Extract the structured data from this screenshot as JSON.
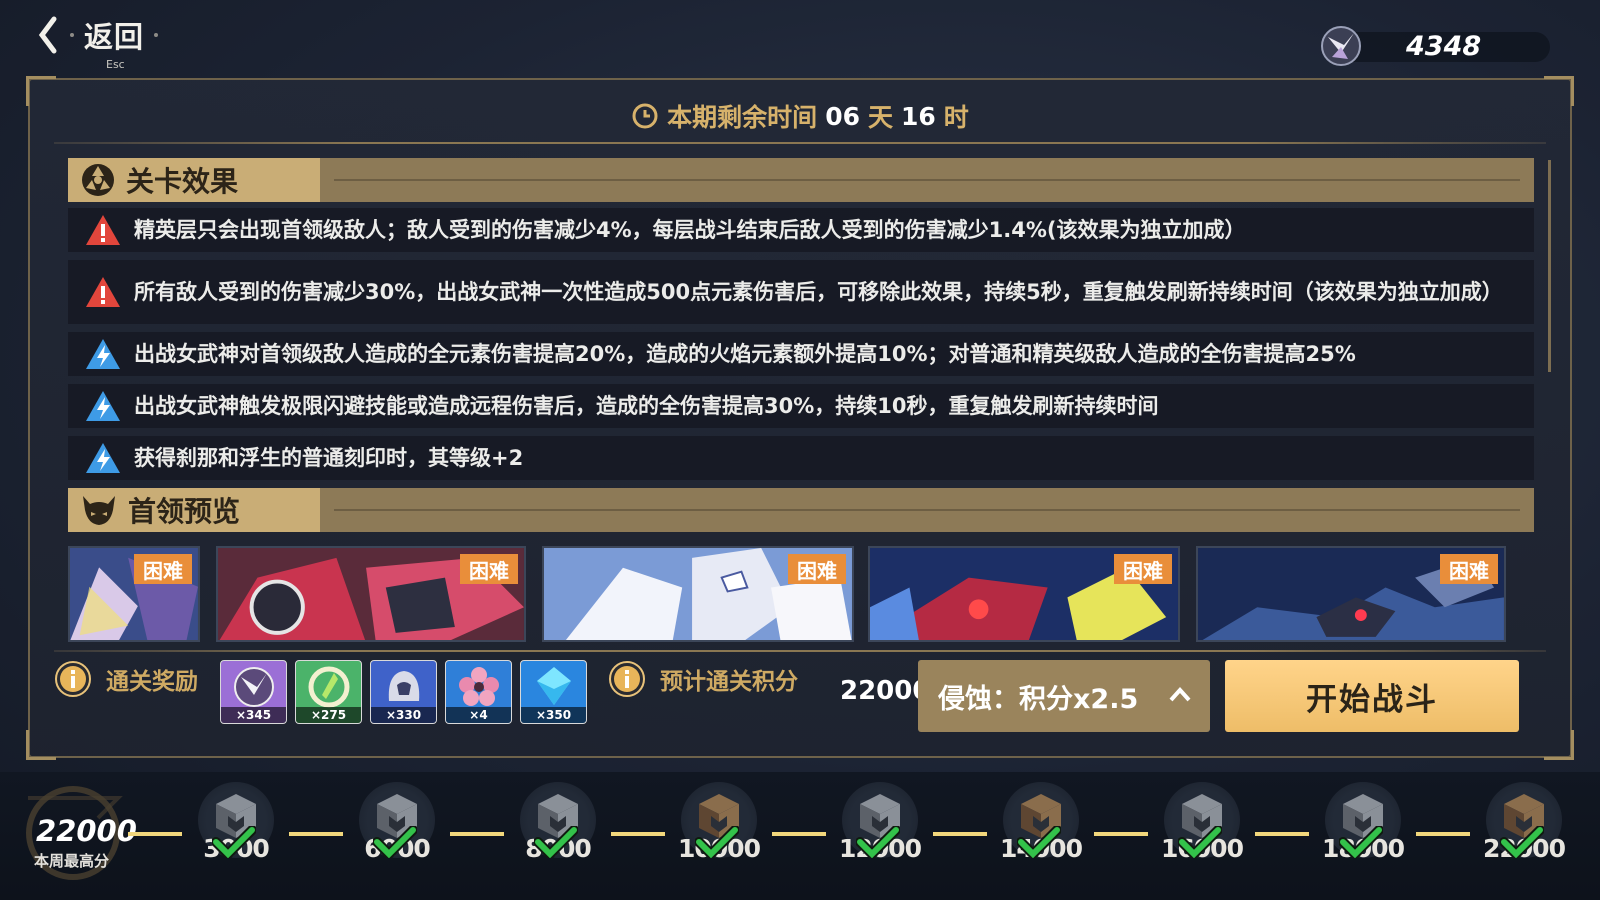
{
  "header": {
    "back_label": "返回",
    "esc_hint": "Esc",
    "currency_amount": "4348"
  },
  "timer": {
    "prefix": "本期剩余时间",
    "days": "06",
    "days_unit": "天",
    "hours": "16",
    "hours_unit": "时"
  },
  "effects_section": {
    "title": "关卡效果",
    "items": [
      {
        "type": "warning",
        "text": "精英层只会出现首领级敌人；敌人受到的伤害减少4%，每层战斗结束后敌人受到的伤害减少1.4%(该效果为独立加成）"
      },
      {
        "type": "warning",
        "text": "所有敌人受到的伤害减少30%，出战女武神一次性造成500点元素伤害后，可移除此效果，持续5秒，重复触发刷新持续时间（该效果为独立加成）"
      },
      {
        "type": "buff",
        "text": "出战女武神对首领级敌人造成的全元素伤害提高20%，造成的火焰元素额外提高10%；对普通和精英级敌人造成的全伤害提高25%"
      },
      {
        "type": "buff",
        "text": "出战女武神触发极限闪避技能或造成远程伤害后，造成的全伤害提高30%，持续10秒，重复触发刷新持续时间"
      },
      {
        "type": "buff",
        "text": "获得刹那和浮生的普通刻印时，其等级+2"
      }
    ]
  },
  "boss_section": {
    "title": "首领预览",
    "bosses": [
      {
        "difficulty": "困难"
      },
      {
        "difficulty": "困难"
      },
      {
        "difficulty": "困难"
      },
      {
        "difficulty": "困难"
      },
      {
        "difficulty": "困难"
      }
    ]
  },
  "rewards": {
    "label": "通关奖励",
    "items": [
      {
        "count": "×345",
        "color": "#9b6fd6",
        "icon": "emblem-icon"
      },
      {
        "count": "×275",
        "color": "#4bb36a",
        "icon": "crystal-ring-icon"
      },
      {
        "count": "×330",
        "color": "#3f62c9",
        "icon": "helmet-icon"
      },
      {
        "count": "×4",
        "color": "#2f7fd8",
        "icon": "flower-icon"
      },
      {
        "count": "×350",
        "color": "#2a86df",
        "icon": "diamond-icon"
      }
    ]
  },
  "score": {
    "label": "预计通关积分",
    "value": "22000"
  },
  "mode_selector": {
    "label": "侵蚀：积分x2.5"
  },
  "start_button": {
    "label": "开始战斗"
  },
  "progress": {
    "best_value": "22000",
    "best_caption": "本周最高分",
    "milestones": [
      {
        "threshold": "3000",
        "tier": "silver",
        "claimed": true
      },
      {
        "threshold": "6000",
        "tier": "silver",
        "claimed": true
      },
      {
        "threshold": "8000",
        "tier": "silver",
        "claimed": true
      },
      {
        "threshold": "10000",
        "tier": "bronze",
        "claimed": true
      },
      {
        "threshold": "12000",
        "tier": "silver",
        "claimed": true
      },
      {
        "threshold": "14000",
        "tier": "bronze",
        "claimed": true
      },
      {
        "threshold": "16000",
        "tier": "silver",
        "claimed": true
      },
      {
        "threshold": "18000",
        "tier": "silver",
        "claimed": true
      },
      {
        "threshold": "22000",
        "tier": "bronze",
        "claimed": true
      }
    ]
  },
  "colors": {
    "accent_gold": "#c9ad76",
    "start_button": "#f2c472",
    "badge_orange": "#e98e3a",
    "check_green": "#33c24a"
  }
}
